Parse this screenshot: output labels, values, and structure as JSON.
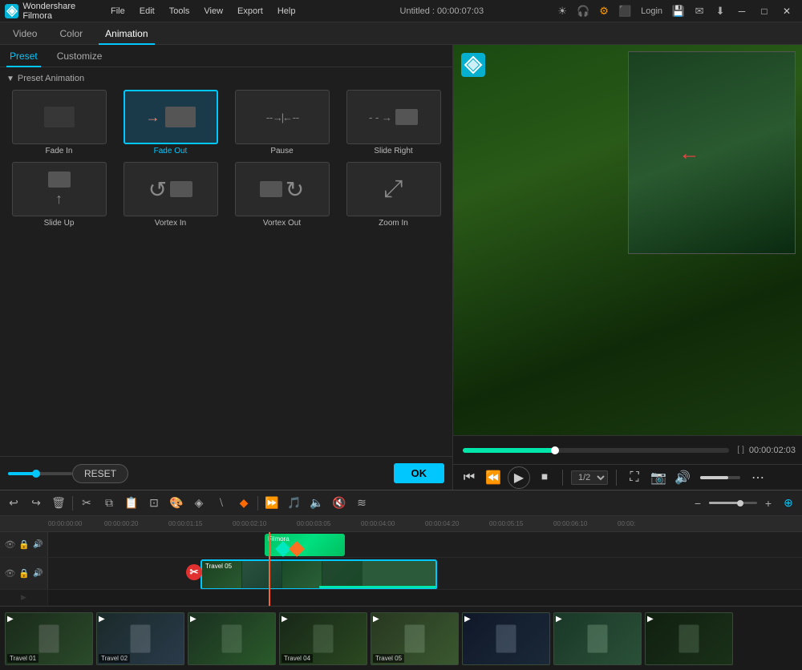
{
  "app": {
    "name": "Wondershare Filmora",
    "title": "Untitled : 00:00:07:03"
  },
  "titlebar": {
    "menu": [
      "File",
      "Edit",
      "Tools",
      "View",
      "Export",
      "Help"
    ],
    "controls": [
      "login_label"
    ],
    "login_label": "Login",
    "window_buttons": [
      "minimize",
      "maximize",
      "close"
    ]
  },
  "tabs": {
    "main": [
      {
        "id": "video",
        "label": "Video"
      },
      {
        "id": "color",
        "label": "Color"
      },
      {
        "id": "animation",
        "label": "Animation",
        "active": true
      }
    ],
    "sub": [
      {
        "id": "preset",
        "label": "Preset",
        "active": true
      },
      {
        "id": "customize",
        "label": "Customize"
      }
    ]
  },
  "preset_section": {
    "header": "Preset Animation",
    "items": [
      {
        "id": "fade-in",
        "label": "Fade In"
      },
      {
        "id": "fade-out",
        "label": "Fade Out",
        "selected": true
      },
      {
        "id": "pause",
        "label": "Pause"
      },
      {
        "id": "slide-right",
        "label": "Slide Right"
      },
      {
        "id": "slide-up",
        "label": "Slide Up"
      },
      {
        "id": "vortex-in",
        "label": "Vortex In"
      },
      {
        "id": "vortex-out",
        "label": "Vortex Out"
      },
      {
        "id": "zoom-in",
        "label": "Zoom In"
      }
    ]
  },
  "buttons": {
    "reset": "RESET",
    "ok": "OK"
  },
  "preview": {
    "time": "00:00:02:03",
    "ratio": "1/2"
  },
  "timeline": {
    "toolbar_icons": [
      "undo",
      "redo",
      "delete",
      "cut",
      "copy",
      "paste",
      "crop",
      "mask",
      "color",
      "split",
      "speed",
      "overlay",
      "transform",
      "keyframe"
    ],
    "ruler_marks": [
      "00:00:00:00",
      "00:00:00:20",
      "00:00:01:15",
      "00:00:02:10",
      "00:00:03:05",
      "00:00:04:00",
      "00:00:04:20",
      "00:00:05:15",
      "00:00:06:10",
      "00:00:"
    ],
    "tracks": [
      {
        "id": "title-track",
        "label": "",
        "type": "title"
      },
      {
        "id": "video-track",
        "label": "",
        "type": "video"
      }
    ],
    "clips": [
      {
        "id": "filmora-title",
        "track": "title-track",
        "label": "Filmora",
        "start": 38,
        "width": 9
      },
      {
        "id": "travel-05",
        "track": "video-track",
        "label": "Travel 05",
        "start": 24,
        "width": 26
      }
    ]
  },
  "media_bin": {
    "clips": [
      {
        "id": "travel01",
        "label": "Travel 01"
      },
      {
        "id": "travel02",
        "label": "Travel 02"
      },
      {
        "id": "travel03",
        "label": ""
      },
      {
        "id": "travel04",
        "label": "Travel 04"
      },
      {
        "id": "travel05",
        "label": "Travel 05"
      }
    ]
  }
}
